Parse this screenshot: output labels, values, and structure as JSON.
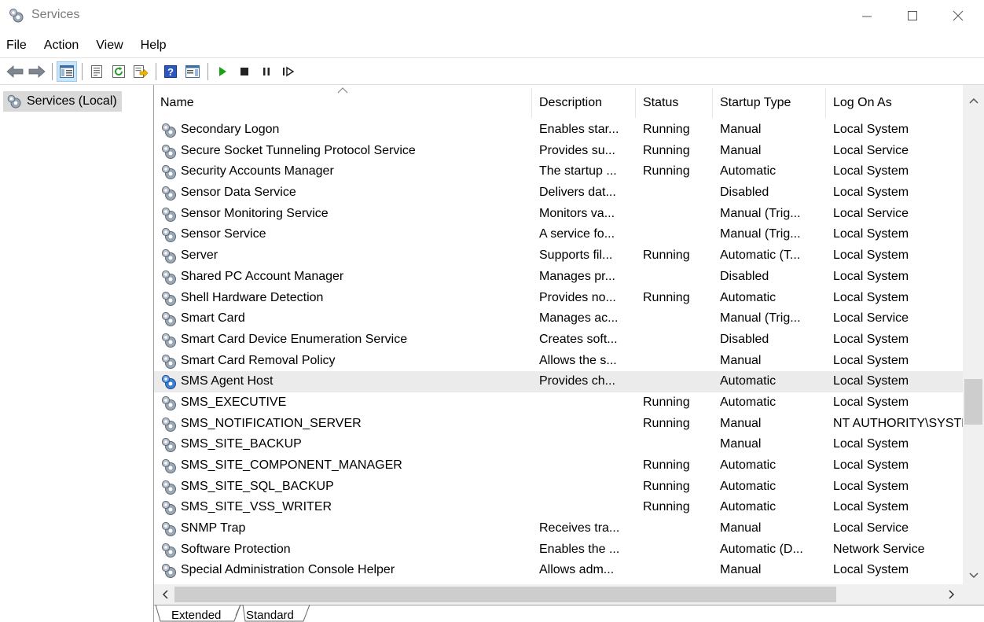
{
  "window": {
    "title": "Services",
    "icon": "services-gear-icon",
    "controls": [
      "minimize-icon",
      "maximize-icon",
      "close-icon"
    ]
  },
  "menu": {
    "items": [
      "File",
      "Action",
      "View",
      "Help"
    ]
  },
  "toolbar": {
    "buttons": [
      "back-arrow-icon",
      "forward-arrow-icon",
      "show-hide-console-tree-icon",
      "properties-icon",
      "refresh-icon",
      "export-list-icon",
      "help-icon",
      "show-hide-action-pane-icon",
      "start-service-icon",
      "stop-service-icon",
      "pause-service-icon",
      "resume-service-icon"
    ]
  },
  "tree": {
    "root_label": "Services (Local)"
  },
  "table": {
    "columns": [
      "Name",
      "Description",
      "Status",
      "Startup Type",
      "Log On As"
    ],
    "sorted_column": "Name",
    "rows": [
      {
        "name": "Secondary Logon",
        "description": "Enables star...",
        "status": "Running",
        "startup": "Manual",
        "logon": "Local System"
      },
      {
        "name": "Secure Socket Tunneling Protocol Service",
        "description": "Provides su...",
        "status": "Running",
        "startup": "Manual",
        "logon": "Local Service"
      },
      {
        "name": "Security Accounts Manager",
        "description": "The startup ...",
        "status": "Running",
        "startup": "Automatic",
        "logon": "Local System"
      },
      {
        "name": "Sensor Data Service",
        "description": "Delivers dat...",
        "status": "",
        "startup": "Disabled",
        "logon": "Local System"
      },
      {
        "name": "Sensor Monitoring Service",
        "description": "Monitors va...",
        "status": "",
        "startup": "Manual (Trig...",
        "logon": "Local Service"
      },
      {
        "name": "Sensor Service",
        "description": "A service fo...",
        "status": "",
        "startup": "Manual (Trig...",
        "logon": "Local System"
      },
      {
        "name": "Server",
        "description": "Supports fil...",
        "status": "Running",
        "startup": "Automatic (T...",
        "logon": "Local System"
      },
      {
        "name": "Shared PC Account Manager",
        "description": "Manages pr...",
        "status": "",
        "startup": "Disabled",
        "logon": "Local System"
      },
      {
        "name": "Shell Hardware Detection",
        "description": "Provides no...",
        "status": "Running",
        "startup": "Automatic",
        "logon": "Local System"
      },
      {
        "name": "Smart Card",
        "description": "Manages ac...",
        "status": "",
        "startup": "Manual (Trig...",
        "logon": "Local Service"
      },
      {
        "name": "Smart Card Device Enumeration Service",
        "description": "Creates soft...",
        "status": "",
        "startup": "Disabled",
        "logon": "Local System"
      },
      {
        "name": "Smart Card Removal Policy",
        "description": "Allows the s...",
        "status": "",
        "startup": "Manual",
        "logon": "Local System"
      },
      {
        "name": "SMS Agent Host",
        "description": "Provides ch...",
        "status": "",
        "startup": "Automatic",
        "logon": "Local System",
        "selected": true
      },
      {
        "name": "SMS_EXECUTIVE",
        "description": "",
        "status": "Running",
        "startup": "Automatic",
        "logon": "Local System"
      },
      {
        "name": "SMS_NOTIFICATION_SERVER",
        "description": "",
        "status": "Running",
        "startup": "Manual",
        "logon": "NT AUTHORITY\\SYSTEM"
      },
      {
        "name": "SMS_SITE_BACKUP",
        "description": "",
        "status": "",
        "startup": "Manual",
        "logon": "Local System"
      },
      {
        "name": "SMS_SITE_COMPONENT_MANAGER",
        "description": "",
        "status": "Running",
        "startup": "Automatic",
        "logon": "Local System"
      },
      {
        "name": "SMS_SITE_SQL_BACKUP",
        "description": "",
        "status": "Running",
        "startup": "Automatic",
        "logon": "Local System"
      },
      {
        "name": "SMS_SITE_VSS_WRITER",
        "description": "",
        "status": "Running",
        "startup": "Automatic",
        "logon": "Local System"
      },
      {
        "name": "SNMP Trap",
        "description": "Receives tra...",
        "status": "",
        "startup": "Manual",
        "logon": "Local Service"
      },
      {
        "name": "Software Protection",
        "description": "Enables the ...",
        "status": "",
        "startup": "Automatic (D...",
        "logon": "Network Service"
      },
      {
        "name": "Special Administration Console Helper",
        "description": "Allows adm...",
        "status": "",
        "startup": "Manual",
        "logon": "Local System"
      }
    ]
  },
  "tabs": {
    "items": [
      "Extended",
      "Standard"
    ],
    "active": "Standard"
  },
  "colors": {
    "selected_row": "#ebebeb",
    "tree_selected": "#d9d9d9",
    "toolbar_pressed": "#cce4f7",
    "play_green": "#16a316"
  }
}
